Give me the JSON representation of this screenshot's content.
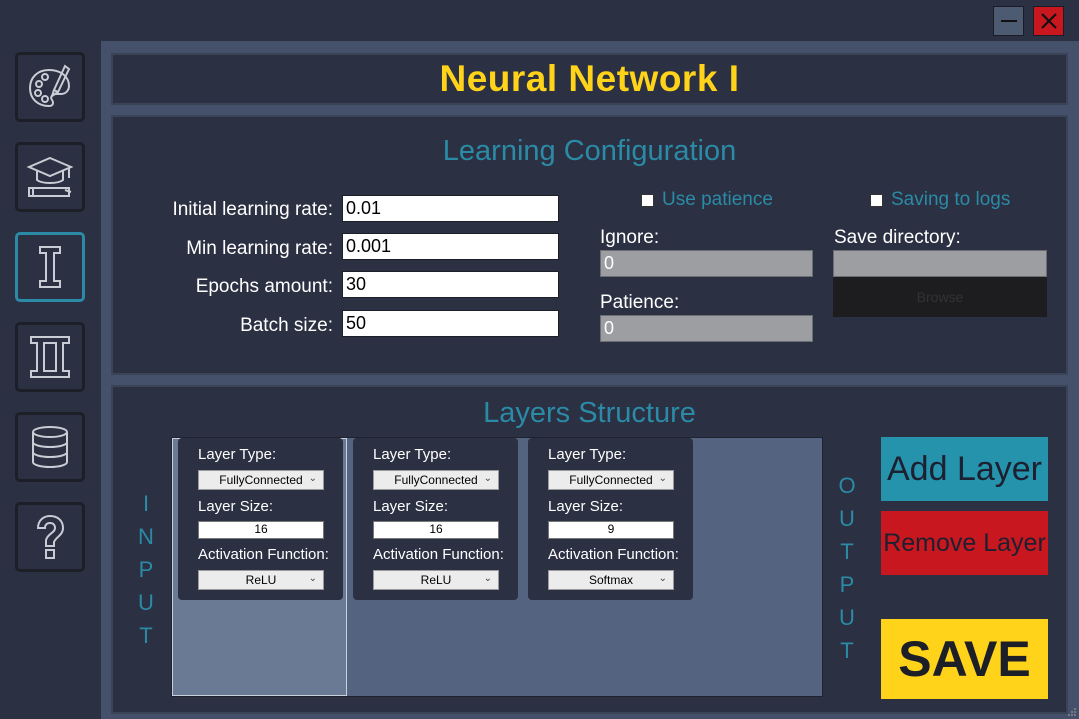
{
  "window": {
    "minimize_label": "—",
    "close_label": "✕"
  },
  "sidebar": {
    "items": [
      {
        "icon": "palette-icon",
        "active": false
      },
      {
        "icon": "graduation-cap-icon",
        "active": false
      },
      {
        "icon": "roman-one-icon",
        "active": true
      },
      {
        "icon": "roman-two-icon",
        "active": false
      },
      {
        "icon": "database-icon",
        "active": false
      },
      {
        "icon": "help-icon",
        "active": false
      }
    ]
  },
  "header": {
    "title": "Neural Network I"
  },
  "learning": {
    "title": "Learning Configuration",
    "initial_lr_label": "Initial learning rate:",
    "initial_lr_value": "0.01",
    "min_lr_label": "Min learning rate:",
    "min_lr_value": "0.001",
    "epochs_label": "Epochs amount:",
    "epochs_value": "30",
    "batch_label": "Batch size:",
    "batch_value": "50",
    "use_patience_label": "Use patience",
    "saving_logs_label": "Saving to logs",
    "ignore_label": "Ignore:",
    "ignore_value": "0",
    "patience_label": "Patience:",
    "patience_value": "0",
    "save_dir_label": "Save directory:",
    "save_dir_value": "",
    "browse_label": "Browse"
  },
  "layers": {
    "title": "Layers Structure",
    "input_label": [
      "I",
      "N",
      "P",
      "U",
      "T"
    ],
    "output_label": [
      "O",
      "U",
      "T",
      "P",
      "U",
      "T"
    ],
    "cards": [
      {
        "type_label": "Layer Type:",
        "type_value": "FullyConnected",
        "size_label": "Layer Size:",
        "size_value": "16",
        "activation_label": "Activation Function:",
        "activation_value": "ReLU"
      },
      {
        "type_label": "Layer Type:",
        "type_value": "FullyConnected",
        "size_label": "Layer Size:",
        "size_value": "16",
        "activation_label": "Activation Function:",
        "activation_value": "ReLU"
      },
      {
        "type_label": "Layer Type:",
        "type_value": "FullyConnected",
        "size_label": "Layer Size:",
        "size_value": "9",
        "activation_label": "Activation Function:",
        "activation_value": "Softmax"
      }
    ],
    "add_label": "Add Layer",
    "remove_label": "Remove Layer",
    "save_label": "SAVE"
  },
  "colors": {
    "accent": "#2b8aa6",
    "title": "#ffd31a",
    "danger": "#c8171e",
    "background": "#2b3042"
  }
}
